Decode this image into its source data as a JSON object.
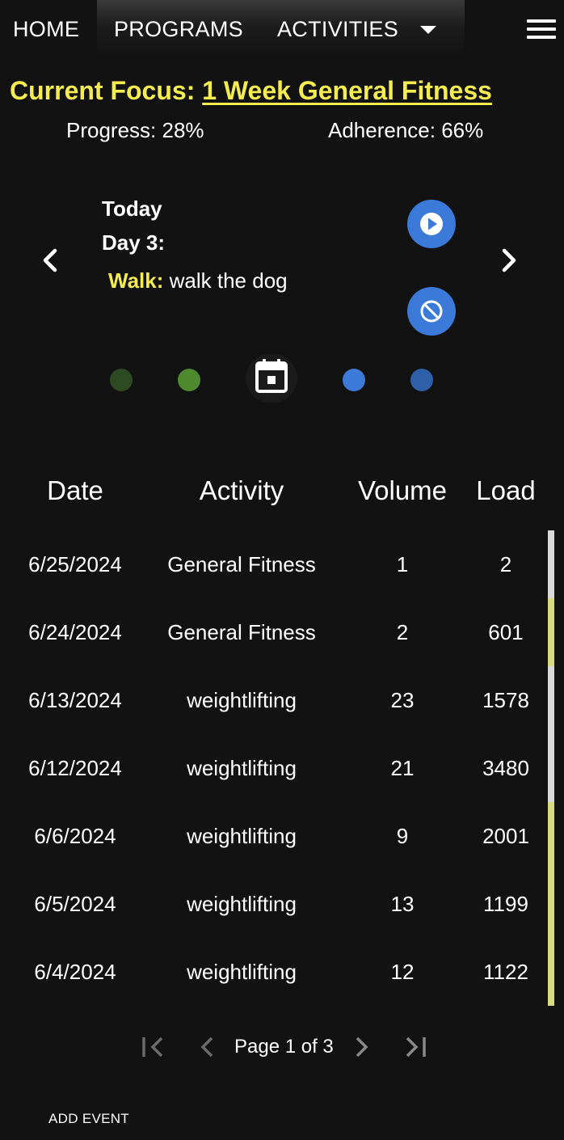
{
  "nav": {
    "items": [
      "HOME",
      "PROGRAMS",
      "ACTIVITIES"
    ],
    "icons": [
      "chevron-down-icon",
      "hamburger-menu-icon"
    ]
  },
  "focus": {
    "prefix": "Current Focus:",
    "program": "1 Week General Fitness",
    "progress": "Progress: 28%",
    "adherence": "Adherence: 66%"
  },
  "today": {
    "label": "Today",
    "day": "Day 3:",
    "activity_type": "Walk:",
    "activity_text": "walk the dog",
    "buttons": [
      "play-icon",
      "skip-icon"
    ]
  },
  "colors": {
    "accent": "#f5ec50",
    "primary_blue": "#3b7ad9",
    "dot_colors": [
      "#2e4a22",
      "#4d8a2e",
      "#3b7ad9",
      "#2f5fa8"
    ]
  },
  "table": {
    "headers": [
      "Date",
      "Activity",
      "Volume",
      "Load"
    ],
    "rows": [
      {
        "date": "6/25/2024",
        "activity": "General Fitness",
        "volume": "1",
        "load": "2",
        "bar": "#d9d9d9"
      },
      {
        "date": "6/24/2024",
        "activity": "General Fitness",
        "volume": "2",
        "load": "601",
        "bar": "#d8dc7e"
      },
      {
        "date": "6/13/2024",
        "activity": "weightlifting",
        "volume": "23",
        "load": "1578",
        "bar": "#d9d9d9"
      },
      {
        "date": "6/12/2024",
        "activity": "weightlifting",
        "volume": "21",
        "load": "3480",
        "bar": "#d9d9d9"
      },
      {
        "date": "6/6/2024",
        "activity": "weightlifting",
        "volume": "9",
        "load": "2001",
        "bar": "#d8dc7e"
      },
      {
        "date": "6/5/2024",
        "activity": "weightlifting",
        "volume": "13",
        "load": "1199",
        "bar": "#d8dc7e"
      },
      {
        "date": "6/4/2024",
        "activity": "weightlifting",
        "volume": "12",
        "load": "1122",
        "bar": "#d8dc7e"
      }
    ]
  },
  "pagination": {
    "text": "Page 1 of 3",
    "icons": [
      "first-page-icon",
      "prev-page-icon",
      "next-page-icon",
      "last-page-icon"
    ]
  },
  "actions": {
    "add_event": "ADD EVENT"
  }
}
